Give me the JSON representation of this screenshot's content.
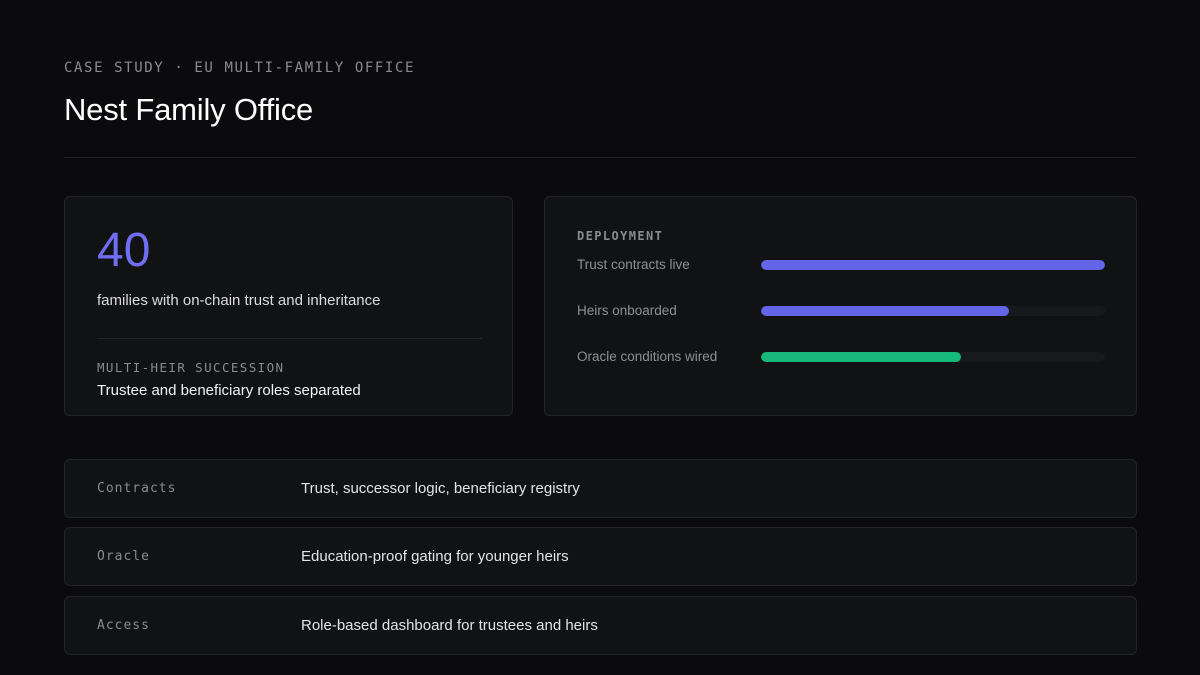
{
  "header": {
    "eyebrow": "CASE STUDY · EU MULTI-FAMILY OFFICE",
    "title": "Nest Family Office"
  },
  "stat": {
    "number": "40",
    "caption": "families with on-chain trust and inheritance",
    "sub_label": "MULTI-HEIR SUCCESSION",
    "sub_value": "Trustee and beneficiary roles separated",
    "number_color": "#6f6ef0"
  },
  "deployment": {
    "heading": "DEPLOYMENT",
    "items": [
      {
        "label": "Trust contracts live",
        "progress": 1.0,
        "color": "#6364e6"
      },
      {
        "label": "Heirs onboarded",
        "progress": 0.72,
        "color": "#6364e6"
      },
      {
        "label": "Oracle conditions wired",
        "progress": 0.58,
        "color": "#17b97b"
      }
    ]
  },
  "details": [
    {
      "key": "Contracts",
      "value": "Trust, successor logic, beneficiary registry"
    },
    {
      "key": "Oracle",
      "value": "Education-proof gating for younger heirs"
    },
    {
      "key": "Access",
      "value": "Role-based dashboard for trustees and heirs"
    }
  ],
  "colors": {
    "background": "#0b0b0d",
    "card": "#111214",
    "accent": "#6f6ef0",
    "success": "#17b97b"
  }
}
